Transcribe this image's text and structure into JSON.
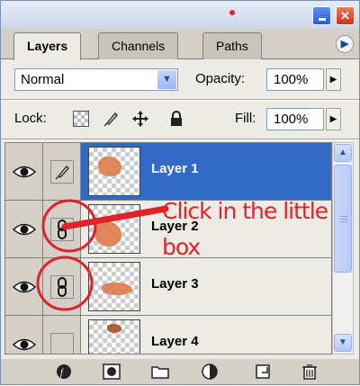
{
  "tabs": [
    {
      "label": "Layers",
      "active": true
    },
    {
      "label": "Channels",
      "active": false
    },
    {
      "label": "Paths",
      "active": false
    }
  ],
  "options": {
    "blend_mode": "Normal",
    "opacity_label": "Opacity:",
    "opacity_value": "100%",
    "lock_label": "Lock:",
    "fill_label": "Fill:",
    "fill_value": "100%"
  },
  "layers": [
    {
      "name": "Layer 1",
      "selected": true,
      "visible": true,
      "link": "brush"
    },
    {
      "name": "Layer 2",
      "selected": false,
      "visible": true,
      "link": "chain"
    },
    {
      "name": "Layer 3",
      "selected": false,
      "visible": true,
      "link": "chain"
    },
    {
      "name": "Layer 4",
      "selected": false,
      "visible": true,
      "link": "empty"
    }
  ],
  "annotation": {
    "text_line1": "Click in the little",
    "text_line2": "box",
    "color": "#e0232a"
  },
  "icons": {
    "eye": "eye-icon",
    "link": "chain-link-icon",
    "brush": "brush-icon",
    "lock_transparent": "checkerboard-icon",
    "lock_image": "brush-icon",
    "lock_position": "move-cross-icon",
    "lock_all": "padlock-icon"
  },
  "colors": {
    "selection": "#316ac5",
    "panel": "#ecebe6",
    "annotation_red": "#e0232a"
  }
}
